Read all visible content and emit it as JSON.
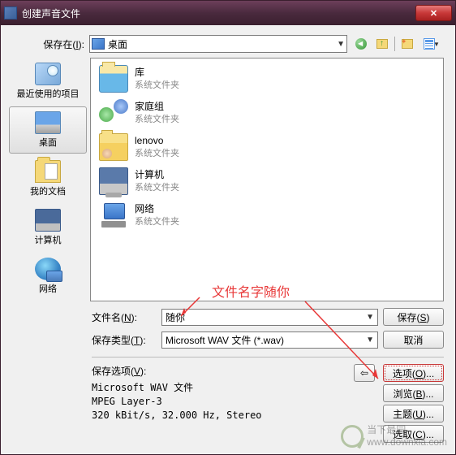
{
  "titlebar": {
    "title": "创建声音文件"
  },
  "saveIn": {
    "label_pre": "保存在(",
    "label_key": "I",
    "label_post": "):",
    "value": "桌面"
  },
  "places": [
    {
      "label": "最近使用的项目",
      "ico": "ico-recent"
    },
    {
      "label": "桌面",
      "ico": "ico-desktop"
    },
    {
      "label": "我的文档",
      "ico": "ico-docs"
    },
    {
      "label": "计算机",
      "ico": "ico-computer"
    },
    {
      "label": "网络",
      "ico": "ico-network"
    }
  ],
  "items": [
    {
      "name": "库",
      "sub": "系统文件夹",
      "ico": "ico-lib"
    },
    {
      "name": "家庭组",
      "sub": "系统文件夹",
      "ico": "ico-homegroup"
    },
    {
      "name": "lenovo",
      "sub": "系统文件夹",
      "ico": "ico-userfolder"
    },
    {
      "name": "计算机",
      "sub": "系统文件夹",
      "ico": "ico-comp-item"
    },
    {
      "name": "网络",
      "sub": "系统文件夹",
      "ico": "ico-net-item"
    }
  ],
  "filename": {
    "label_pre": "文件名(",
    "label_key": "N",
    "label_post": "):",
    "value": "随你"
  },
  "filetype": {
    "label_pre": "保存类型(",
    "label_key": "T",
    "label_post": "):",
    "value": "Microsoft WAV 文件 (*.wav)"
  },
  "buttons": {
    "save_pre": "保存(",
    "save_key": "S",
    "save_post": ")",
    "cancel": "取消",
    "options_pre": "选项(",
    "options_key": "O",
    "options_post": ")...",
    "browse_pre": "浏览(",
    "browse_key": "B",
    "browse_post": ")...",
    "theme_pre": "主题(",
    "theme_key": "U",
    "theme_post": ")...",
    "select_pre": "选取(",
    "select_key": "C",
    "select_post": ")..."
  },
  "saveOptions": {
    "label_pre": "保存选项(",
    "label_key": "V",
    "label_post": "):",
    "line1": "Microsoft WAV 文件",
    "line2": "MPEG Layer-3",
    "line3": "320 kBit/s, 32.000 Hz, Stereo"
  },
  "backArrow": "⇦",
  "annotation": {
    "text": "文件名字随你"
  },
  "watermark": {
    "line1": "当下最园",
    "line2": "www.downxia.com"
  }
}
